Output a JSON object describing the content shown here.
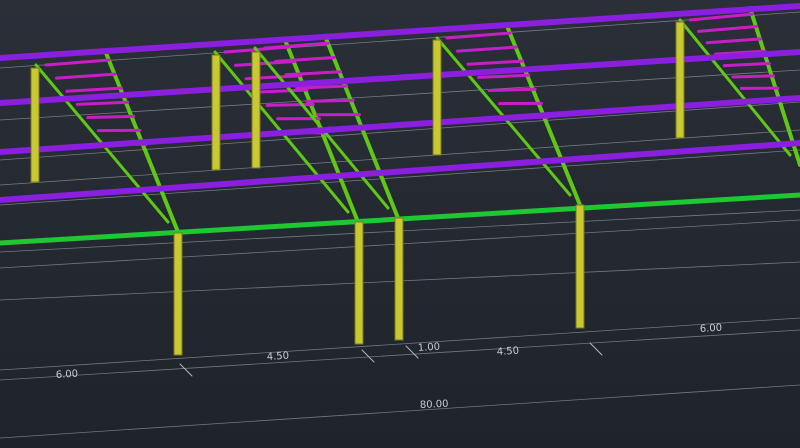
{
  "viewport": {
    "background": "#22272f",
    "colors": {
      "purlin": "#8a1fe0",
      "eave_beam": "#1ec832",
      "rafter": "#5fc814",
      "truss_web": "#c81ec8",
      "column": "#c8c832",
      "dimension_line": "#b4b8c0"
    }
  },
  "dimensions": {
    "d1": "6.00",
    "d2": "4.50",
    "d3": "1.00",
    "d4": "4.50",
    "d5": "6.00",
    "total": "80.00"
  }
}
